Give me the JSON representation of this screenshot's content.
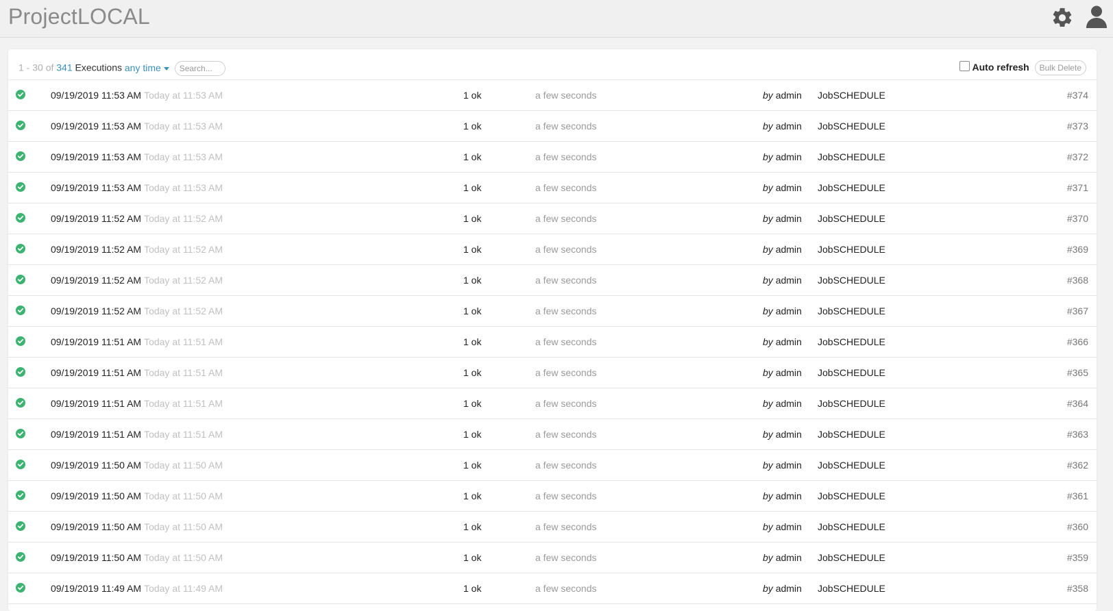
{
  "app": {
    "title": "ProjectLOCAL"
  },
  "header": {
    "range": "1 - 30 of",
    "total": "341",
    "executions_label": "Executions",
    "time_filter": "any time",
    "search_placeholder": "Search...",
    "auto_refresh_label": "Auto refresh",
    "bulk_delete_label": "Bulk Delete"
  },
  "colors": {
    "accent": "#3a90b8",
    "success": "#3cb371"
  },
  "icons": {
    "settings": "gear-icon",
    "user": "user-icon",
    "status": "check-circle-icon"
  },
  "executions": [
    {
      "timestamp": "09/19/2019 11:53 AM",
      "relative": "Today at 11:53 AM",
      "result": "1 ok",
      "duration": "a few seconds",
      "by_label": "by",
      "user": "admin",
      "job": "JobSCHEDULE",
      "id": "#374"
    },
    {
      "timestamp": "09/19/2019 11:53 AM",
      "relative": "Today at 11:53 AM",
      "result": "1 ok",
      "duration": "a few seconds",
      "by_label": "by",
      "user": "admin",
      "job": "JobSCHEDULE",
      "id": "#373"
    },
    {
      "timestamp": "09/19/2019 11:53 AM",
      "relative": "Today at 11:53 AM",
      "result": "1 ok",
      "duration": "a few seconds",
      "by_label": "by",
      "user": "admin",
      "job": "JobSCHEDULE",
      "id": "#372"
    },
    {
      "timestamp": "09/19/2019 11:53 AM",
      "relative": "Today at 11:53 AM",
      "result": "1 ok",
      "duration": "a few seconds",
      "by_label": "by",
      "user": "admin",
      "job": "JobSCHEDULE",
      "id": "#371"
    },
    {
      "timestamp": "09/19/2019 11:52 AM",
      "relative": "Today at 11:52 AM",
      "result": "1 ok",
      "duration": "a few seconds",
      "by_label": "by",
      "user": "admin",
      "job": "JobSCHEDULE",
      "id": "#370"
    },
    {
      "timestamp": "09/19/2019 11:52 AM",
      "relative": "Today at 11:52 AM",
      "result": "1 ok",
      "duration": "a few seconds",
      "by_label": "by",
      "user": "admin",
      "job": "JobSCHEDULE",
      "id": "#369"
    },
    {
      "timestamp": "09/19/2019 11:52 AM",
      "relative": "Today at 11:52 AM",
      "result": "1 ok",
      "duration": "a few seconds",
      "by_label": "by",
      "user": "admin",
      "job": "JobSCHEDULE",
      "id": "#368"
    },
    {
      "timestamp": "09/19/2019 11:52 AM",
      "relative": "Today at 11:52 AM",
      "result": "1 ok",
      "duration": "a few seconds",
      "by_label": "by",
      "user": "admin",
      "job": "JobSCHEDULE",
      "id": "#367"
    },
    {
      "timestamp": "09/19/2019 11:51 AM",
      "relative": "Today at 11:51 AM",
      "result": "1 ok",
      "duration": "a few seconds",
      "by_label": "by",
      "user": "admin",
      "job": "JobSCHEDULE",
      "id": "#366"
    },
    {
      "timestamp": "09/19/2019 11:51 AM",
      "relative": "Today at 11:51 AM",
      "result": "1 ok",
      "duration": "a few seconds",
      "by_label": "by",
      "user": "admin",
      "job": "JobSCHEDULE",
      "id": "#365"
    },
    {
      "timestamp": "09/19/2019 11:51 AM",
      "relative": "Today at 11:51 AM",
      "result": "1 ok",
      "duration": "a few seconds",
      "by_label": "by",
      "user": "admin",
      "job": "JobSCHEDULE",
      "id": "#364"
    },
    {
      "timestamp": "09/19/2019 11:51 AM",
      "relative": "Today at 11:51 AM",
      "result": "1 ok",
      "duration": "a few seconds",
      "by_label": "by",
      "user": "admin",
      "job": "JobSCHEDULE",
      "id": "#363"
    },
    {
      "timestamp": "09/19/2019 11:50 AM",
      "relative": "Today at 11:50 AM",
      "result": "1 ok",
      "duration": "a few seconds",
      "by_label": "by",
      "user": "admin",
      "job": "JobSCHEDULE",
      "id": "#362"
    },
    {
      "timestamp": "09/19/2019 11:50 AM",
      "relative": "Today at 11:50 AM",
      "result": "1 ok",
      "duration": "a few seconds",
      "by_label": "by",
      "user": "admin",
      "job": "JobSCHEDULE",
      "id": "#361"
    },
    {
      "timestamp": "09/19/2019 11:50 AM",
      "relative": "Today at 11:50 AM",
      "result": "1 ok",
      "duration": "a few seconds",
      "by_label": "by",
      "user": "admin",
      "job": "JobSCHEDULE",
      "id": "#360"
    },
    {
      "timestamp": "09/19/2019 11:50 AM",
      "relative": "Today at 11:50 AM",
      "result": "1 ok",
      "duration": "a few seconds",
      "by_label": "by",
      "user": "admin",
      "job": "JobSCHEDULE",
      "id": "#359"
    },
    {
      "timestamp": "09/19/2019 11:49 AM",
      "relative": "Today at 11:49 AM",
      "result": "1 ok",
      "duration": "a few seconds",
      "by_label": "by",
      "user": "admin",
      "job": "JobSCHEDULE",
      "id": "#358"
    }
  ]
}
